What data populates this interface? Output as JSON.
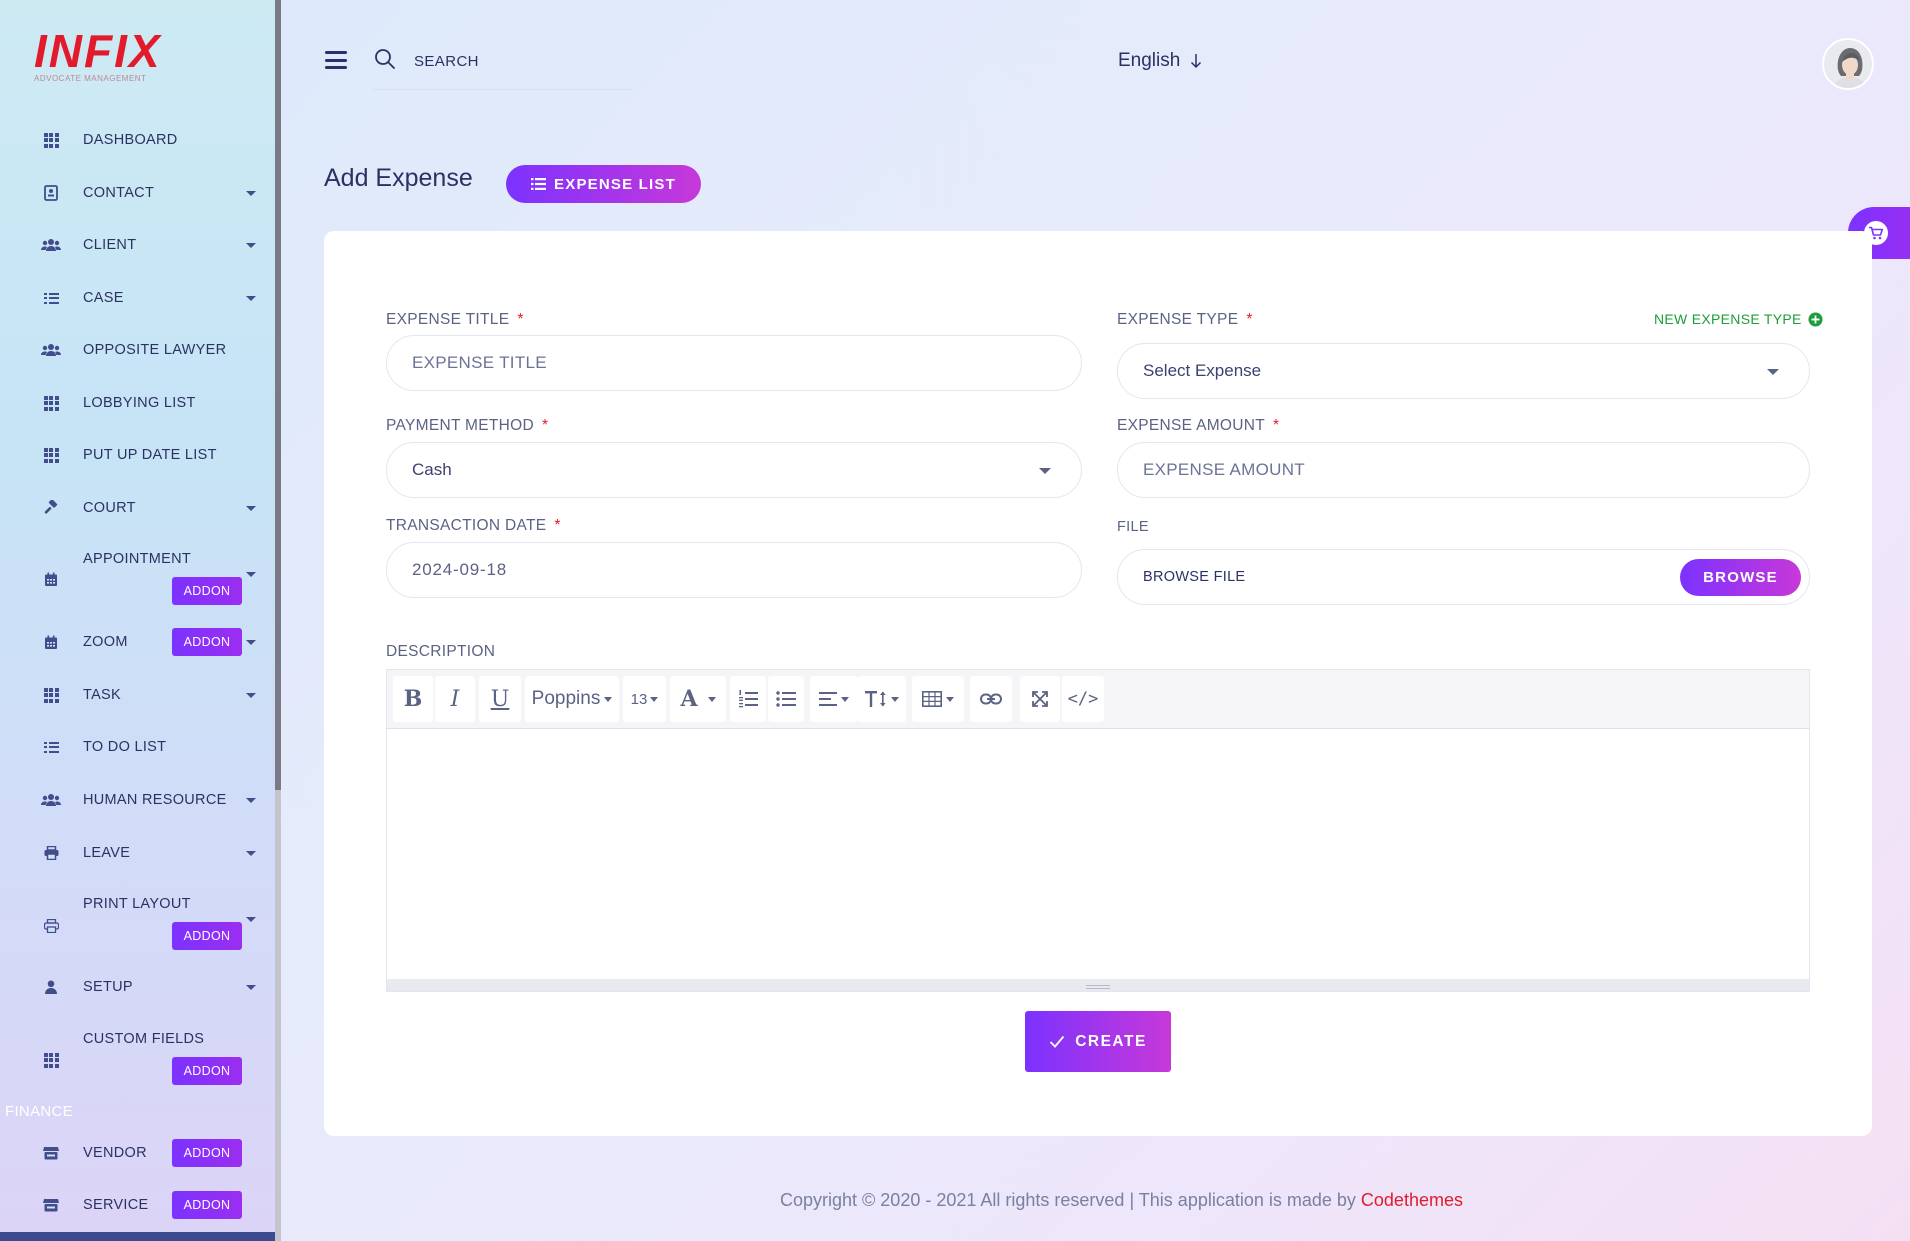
{
  "app": {
    "logo_text": "INFIX",
    "logo_subtitle": "ADVOCATE MANAGEMENT"
  },
  "sidebar": {
    "items": [
      {
        "label": "DASHBOARD",
        "icon": "grid-icon"
      },
      {
        "label": "CONTACT",
        "icon": "contact-card-icon",
        "has_submenu": true
      },
      {
        "label": "CLIENT",
        "icon": "users-icon",
        "has_submenu": true
      },
      {
        "label": "CASE",
        "icon": "list-icon",
        "has_submenu": true
      },
      {
        "label": "OPPOSITE LAWYER",
        "icon": "users-icon"
      },
      {
        "label": "LOBBYING LIST",
        "icon": "grid-icon"
      },
      {
        "label": "PUT UP DATE LIST",
        "icon": "grid-icon"
      },
      {
        "label": "COURT",
        "icon": "gavel-icon",
        "has_submenu": true
      },
      {
        "label": "APPOINTMENT",
        "icon": "calendar-icon",
        "has_submenu": true,
        "badge": "ADDON"
      },
      {
        "label": "ZOOM",
        "icon": "calendar-icon",
        "has_submenu": true,
        "badge": "ADDON"
      },
      {
        "label": "TASK",
        "icon": "grid-icon",
        "has_submenu": true
      },
      {
        "label": "TO DO LIST",
        "icon": "list-icon"
      },
      {
        "label": "HUMAN RESOURCE",
        "icon": "users-icon",
        "has_submenu": true
      },
      {
        "label": "LEAVE",
        "icon": "printer-icon",
        "has_submenu": true
      },
      {
        "label": "PRINT LAYOUT",
        "icon": "print-layout-icon",
        "has_submenu": true,
        "badge": "ADDON"
      },
      {
        "label": "SETUP",
        "icon": "user-icon",
        "has_submenu": true
      },
      {
        "label": "CUSTOM FIELDS",
        "icon": "grid-icon",
        "badge": "ADDON"
      },
      {
        "label": "VENDOR",
        "icon": "store-icon",
        "badge": "ADDON"
      },
      {
        "label": "SERVICE",
        "icon": "store-icon",
        "badge": "ADDON"
      }
    ],
    "section_finance": "FINANCE"
  },
  "topbar": {
    "search_placeholder": "SEARCH",
    "language": "English"
  },
  "page": {
    "title": "Add Expense",
    "list_button": "EXPENSE LIST"
  },
  "form": {
    "expense_title": {
      "label": "EXPENSE TITLE",
      "placeholder": "EXPENSE TITLE",
      "required": "*"
    },
    "expense_type": {
      "label": "EXPENSE TYPE",
      "value": "Select Expense",
      "required": "*",
      "new_link": "NEW EXPENSE TYPE"
    },
    "payment_method": {
      "label": "PAYMENT METHOD",
      "value": "Cash",
      "required": "*"
    },
    "expense_amount": {
      "label": "EXPENSE AMOUNT",
      "placeholder": "EXPENSE AMOUNT",
      "required": "*"
    },
    "transaction_date": {
      "label": "TRANSACTION DATE",
      "value": "2024-09-18",
      "required": "*"
    },
    "file": {
      "label": "FILE",
      "placeholder": "BROWSE FILE",
      "browse_button": "BROWSE"
    },
    "description": {
      "label": "DESCRIPTION"
    },
    "create_button": "CREATE"
  },
  "editor_toolbar": {
    "bold": "B",
    "italic": "I",
    "underline": "U",
    "font_family": "Poppins",
    "font_size": "13",
    "font_color": "A",
    "code_view": "</>"
  },
  "footer": {
    "text": "Copyright © 2020 - 2021 All rights reserved | This application is made by ",
    "link": "Codethemes"
  },
  "colors": {
    "accent_start": "#7c32ff",
    "accent_end": "#c738d8",
    "required": "#e21b2c",
    "success": "#1e9d3a",
    "text_dark": "#2b3263"
  }
}
